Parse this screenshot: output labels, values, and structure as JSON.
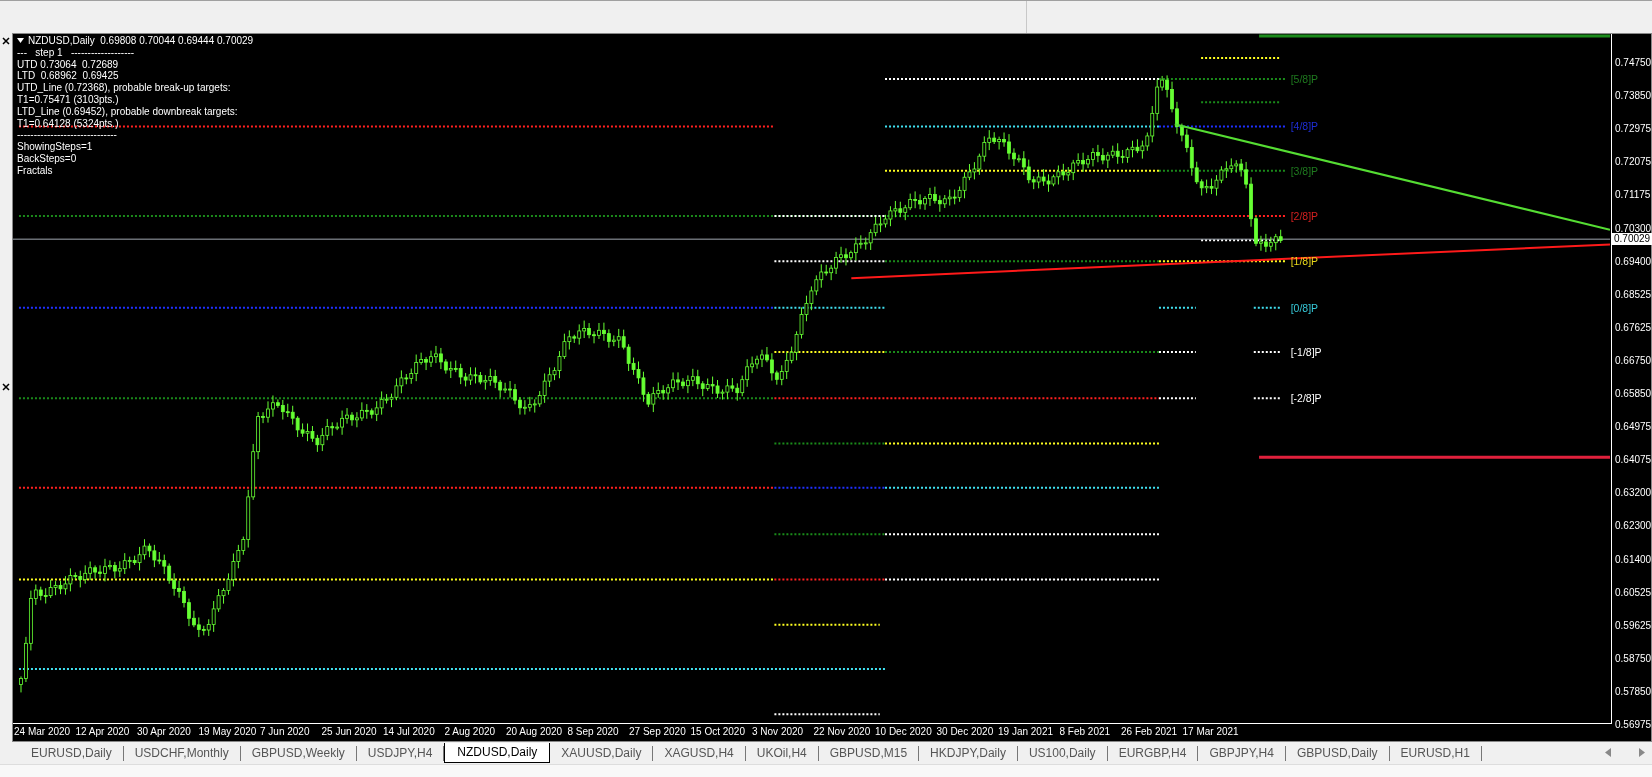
{
  "chart": {
    "title_line": "NZDUSD,Daily  0.69808 0.70044 0.69444 0.70029",
    "info_lines": [
      "---   step 1   -------------------",
      "UTD 0.73064  0.72689",
      "LTD  0.68962  0.69425",
      "UTD_Line (0.72368), probable break-up targets:",
      "T1=0.75471 (3103pts.)",
      "LTD_Line (0.69452), probable downbreak targets:",
      "T1=0.64128 (5324pts.)",
      "------------------------------",
      "ShowingSteps=1",
      "BackSteps=0",
      "Fractals"
    ],
    "murrey_levels": [
      {
        "label": "[5/8]P",
        "color": "#1f7a1f"
      },
      {
        "label": "[4/8]P",
        "color": "#1e2ed6"
      },
      {
        "label": "[3/8]P",
        "color": "#1f7a1f"
      },
      {
        "label": "[2/8]P",
        "color": "#d42020"
      },
      {
        "label": "[1/8]P",
        "color": "#e8d81a"
      },
      {
        "label": "[0/8]P",
        "color": "#36c8d8"
      },
      {
        "label": "[-1/8]P",
        "color": "#ffffff"
      },
      {
        "label": "[-2/8]P",
        "color": "#ffffff"
      }
    ],
    "price_axis": [
      "0.74750",
      "0.73850",
      "0.72975",
      "0.72075",
      "0.71175",
      "0.70300",
      "0.69400",
      "0.68525",
      "0.67625",
      "0.66750",
      "0.65850",
      "0.64975",
      "0.64075",
      "0.63200",
      "0.62300",
      "0.61400",
      "0.60525",
      "0.59625",
      "0.58750",
      "0.57850",
      "0.56975"
    ],
    "current_price": "0.70029",
    "date_axis": [
      "24 Mar 2020",
      "12 Apr 2020",
      "30 Apr 2020",
      "19 May 2020",
      "7 Jun 2020",
      "25 Jun 2020",
      "14 Jul 2020",
      "2 Aug 2020",
      "20 Aug 2020",
      "8 Sep 2020",
      "27 Sep 2020",
      "15 Oct 2020",
      "3 Nov 2020",
      "22 Nov 2020",
      "10 Dec 2020",
      "30 Dec 2020",
      "19 Jan 2021",
      "8 Feb 2021",
      "26 Feb 2021",
      "17 Mar 2021"
    ]
  },
  "tabs": [
    {
      "label": "EURUSD,Daily",
      "selected": false
    },
    {
      "label": "USDCHF,Monthly",
      "selected": false
    },
    {
      "label": "GBPUSD,Weekly",
      "selected": false
    },
    {
      "label": "USDJPY,H4",
      "selected": false
    },
    {
      "label": "NZDUSD,Daily",
      "selected": true
    },
    {
      "label": "XAUUSD,Daily",
      "selected": false
    },
    {
      "label": "XAGUSD,H4",
      "selected": false
    },
    {
      "label": "UKOil,H4",
      "selected": false
    },
    {
      "label": "GBPUSD,M15",
      "selected": false
    },
    {
      "label": "HKDJPY,Daily",
      "selected": false
    },
    {
      "label": "US100,Daily",
      "selected": false
    },
    {
      "label": "EURGBP,H4",
      "selected": false
    },
    {
      "label": "GBPJPY,H4",
      "selected": false
    },
    {
      "label": "GBPUSD,Daily",
      "selected": false
    },
    {
      "label": "EURUSD,H1",
      "selected": false
    }
  ]
}
